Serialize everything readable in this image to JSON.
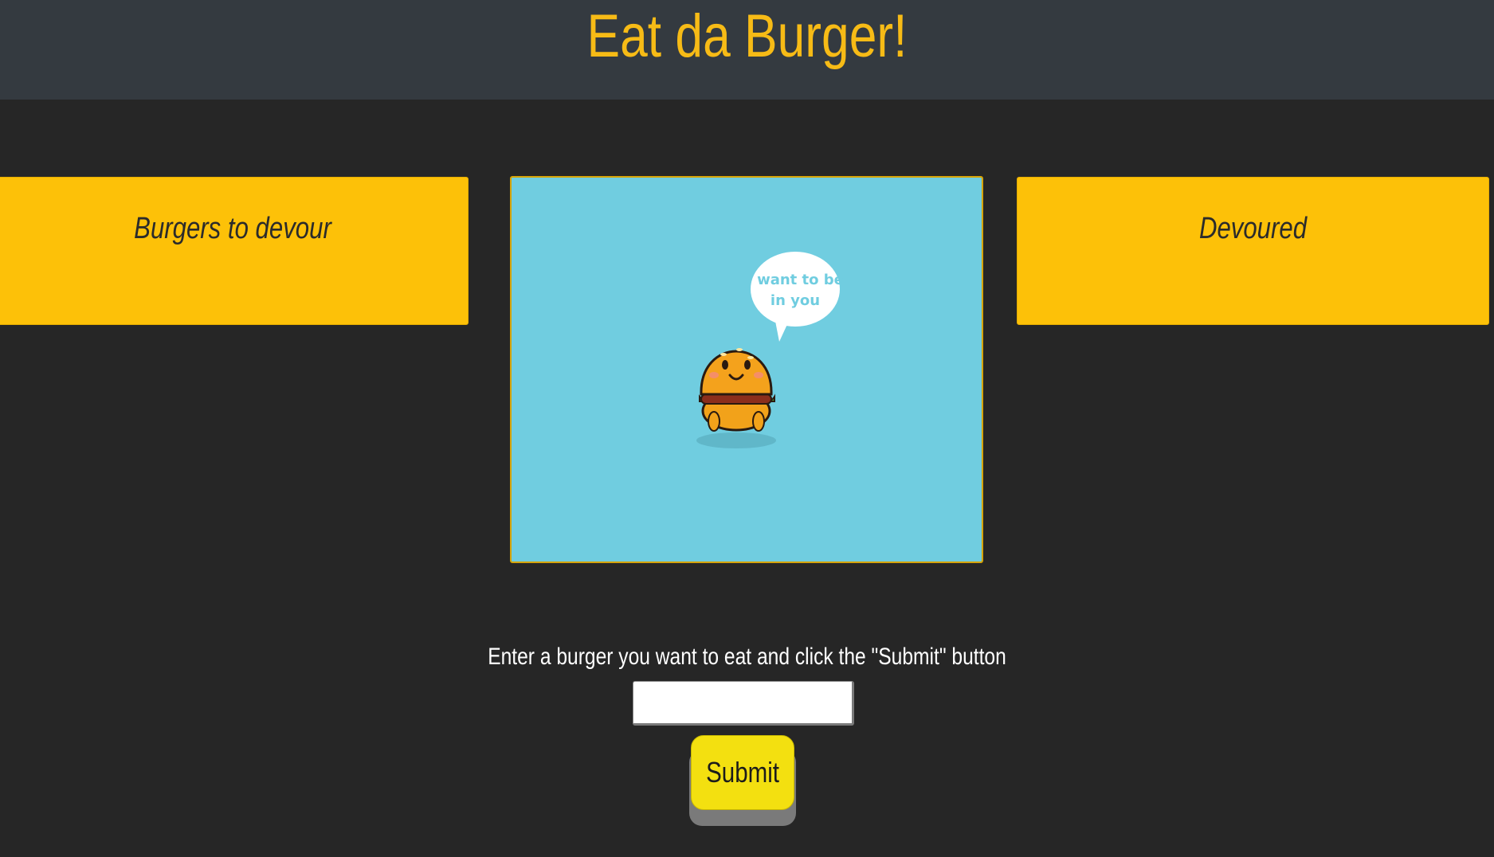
{
  "header": {
    "title": "Eat da Burger!"
  },
  "columns": {
    "to_devour": {
      "title": "Burgers to devour"
    },
    "devoured": {
      "title": "Devoured"
    }
  },
  "hero_image": {
    "speech_bubble_line1": "I want to be",
    "speech_bubble_line2": "in you",
    "icon": "cute-burger-illustration"
  },
  "form": {
    "instructions": "Enter a burger you want to eat and click the \"Submit\" button",
    "input_value": "",
    "submit_label": "Submit"
  },
  "colors": {
    "background": "#262626",
    "header_bg": "#343a40",
    "title": "#f7bb16",
    "card": "#fdc108",
    "image_bg": "#70cde0",
    "button": "#f3e010"
  }
}
